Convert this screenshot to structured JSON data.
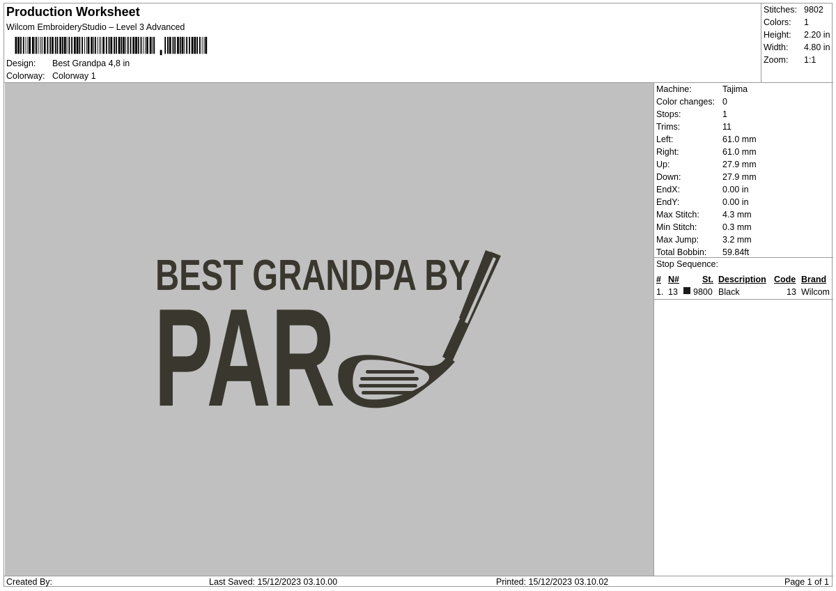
{
  "header": {
    "title": "Production Worksheet",
    "software": "Wilcom EmbroideryStudio – Level 3 Advanced",
    "design_label": "Design:",
    "design_value": "Best Grandpa 4,8 in",
    "colorway_label": "Colorway:",
    "colorway_value": "Colorway 1"
  },
  "summary": {
    "stitches_label": "Stitches:",
    "stitches_value": "9802",
    "colors_label": "Colors:",
    "colors_value": "1",
    "height_label": "Height:",
    "height_value": "2.20 in",
    "width_label": "Width:",
    "width_value": "4.80 in",
    "zoom_label": "Zoom:",
    "zoom_value": "1:1"
  },
  "design": {
    "line1": "BEST GRANDPA BY",
    "line2": "PAR",
    "thread_color": "#3a372f",
    "background_color": "#c0c0c0"
  },
  "machine_info": [
    {
      "label": "Machine:",
      "value": "Tajima"
    },
    {
      "label": "Color changes:",
      "value": "0"
    },
    {
      "label": "Stops:",
      "value": "1"
    },
    {
      "label": "Trims:",
      "value": "11"
    },
    {
      "label": "Left:",
      "value": "61.0 mm"
    },
    {
      "label": "Right:",
      "value": "61.0 mm"
    },
    {
      "label": "Up:",
      "value": "27.9 mm"
    },
    {
      "label": "Down:",
      "value": "27.9 mm"
    },
    {
      "label": "EndX:",
      "value": "0.00 in"
    },
    {
      "label": "EndY:",
      "value": "0.00 in"
    },
    {
      "label": "Max Stitch:",
      "value": "4.3 mm"
    },
    {
      "label": "Min Stitch:",
      "value": "0.3 mm"
    },
    {
      "label": "Max Jump:",
      "value": "3.2 mm"
    },
    {
      "label": "Total Bobbin:",
      "value": "59.84ft"
    }
  ],
  "stop_sequence": {
    "title": "Stop Sequence:",
    "columns": {
      "num": "#",
      "n": "N#",
      "st": "St.",
      "description": "Description",
      "code": "Code",
      "brand": "Brand"
    },
    "rows": [
      {
        "num": "1.",
        "n": "13",
        "swatch": "#1a1a1a",
        "st": "9800",
        "description": "Black",
        "code": "13",
        "brand": "Wilcom"
      }
    ]
  },
  "footer": {
    "created_by": "Created By:",
    "last_saved": "Last Saved: 15/12/2023 03.10.00",
    "printed": "Printed: 15/12/2023 03.10.02",
    "page": "Page 1 of 1"
  }
}
